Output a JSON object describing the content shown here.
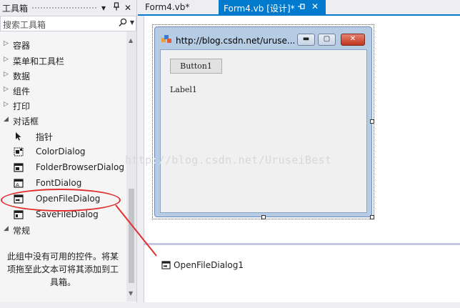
{
  "toolbox": {
    "title": "工具箱",
    "header_buttons": [
      "▾",
      "ᛒ",
      "✕"
    ],
    "search_placeholder": "搜索工具箱",
    "categories": [
      {
        "label": "容器",
        "expanded": false
      },
      {
        "label": "菜单和工具栏",
        "expanded": false
      },
      {
        "label": "数据",
        "expanded": false
      },
      {
        "label": "组件",
        "expanded": false
      },
      {
        "label": "打印",
        "expanded": false
      },
      {
        "label": "对话框",
        "expanded": true
      },
      {
        "label": "常规",
        "expanded": true
      }
    ],
    "dialog_items": [
      {
        "label": "指针",
        "icon": "pointer-icon"
      },
      {
        "label": "ColorDialog",
        "icon": "color-dialog-icon"
      },
      {
        "label": "FolderBrowserDialog",
        "icon": "folder-browser-dialog-icon"
      },
      {
        "label": "FontDialog",
        "icon": "font-dialog-icon"
      },
      {
        "label": "OpenFileDialog",
        "icon": "open-file-dialog-icon"
      },
      {
        "label": "SaveFileDialog",
        "icon": "save-file-dialog-icon"
      }
    ],
    "empty_message": "此组中没有可用的控件。将某项拖至此文本可将其添加到工具箱。"
  },
  "tabs": [
    {
      "label": "Form4.vb*",
      "active": false
    },
    {
      "label": "Form4.vb [设计]*",
      "active": true
    }
  ],
  "designer": {
    "form_title": "http://blog.csdn.net/uruse...",
    "button_text": "Button1",
    "label_text": "Label1",
    "watermark": "http://blog.csdn.net/UruseiBest",
    "tray_component": "OpenFileDialog1"
  },
  "colors": {
    "accent": "#007acc",
    "annotation": "#e03030"
  }
}
